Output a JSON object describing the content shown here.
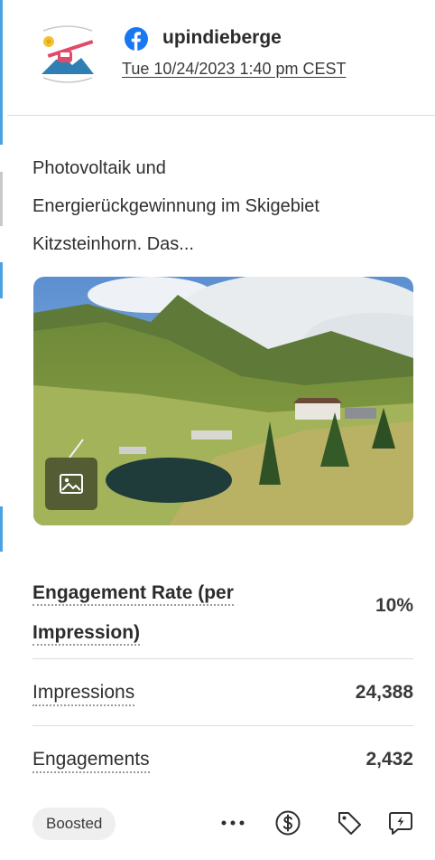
{
  "header": {
    "account_name": "upindieberge",
    "timestamp": "Tue 10/24/2023 1:40 pm CEST"
  },
  "post": {
    "text_lines": [
      "Photovoltaik und",
      "Energierückgewinnung im Skigebiet",
      "Kitzsteinhorn. Das..."
    ]
  },
  "metrics": {
    "engagement_rate": {
      "label_line1": "Engagement Rate (per",
      "label_line2": "Impression)",
      "value": "10%"
    },
    "impressions": {
      "label": "Impressions",
      "value": "24,388"
    },
    "engagements": {
      "label": "Engagements",
      "value": "2,432"
    }
  },
  "footer": {
    "boosted_label": "Boosted",
    "more_icon": "•••",
    "actions": [
      "more-icon",
      "dollar-circle-icon",
      "tag-icon",
      "boost-icon"
    ]
  },
  "colors": {
    "facebook_blue": "#1877f2",
    "accent_tab": "#3b8fd9",
    "divider": "#dcdcdc"
  }
}
